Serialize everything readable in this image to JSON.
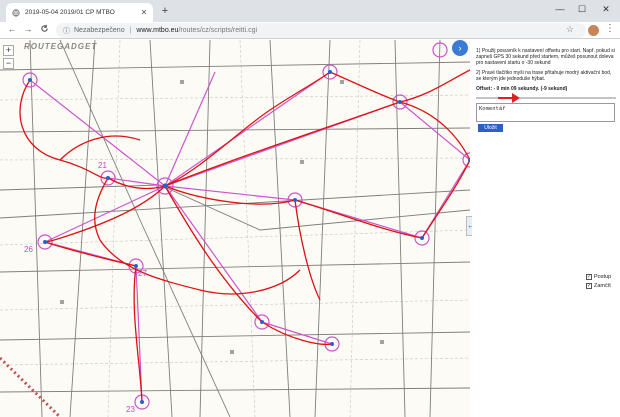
{
  "browser": {
    "tab_title": "2019-05-04 2019/01 ČP MTBO",
    "newtab_label": "+",
    "window": {
      "minimize": "—",
      "maximize": "☐",
      "close": "✕"
    },
    "nav": {
      "back": "←",
      "forward": "→",
      "reload": "C"
    },
    "omnibox": {
      "security": "Nezabezpečeno",
      "host": "www.mtbo.eu",
      "path": "/routes/cz/scripts/reitti.cgi"
    }
  },
  "map": {
    "logo": "ROUTEGADGET",
    "zoom_in": "+",
    "zoom_out": "−",
    "panel_toggle": "›",
    "side_handle": "↔",
    "control_numbers": [
      "21",
      "26",
      "27",
      "23"
    ],
    "colors": {
      "course": "#cc55cc",
      "route": "#dd1111",
      "water": "#3a7bd5"
    }
  },
  "panel": {
    "instruction1": "1) Použij posuvník k nastavení offsetu pro start. Např. pokud si zapneš GPS 30 sekund před startem, můžeš posunout doleva pro nastavení startu o -30 sekund",
    "instruction2": "2) Pravé tlačítko myši na trase přitahuje modrý aktivační bod, se kterým jde jednoduše hýbat.",
    "offset_label": "Offset: - 0 min 09 sekundy. (-9 sekund)",
    "comment_placeholder": "Komentář",
    "save_label": "Uložit",
    "checkboxes": [
      {
        "label": "Postup",
        "checked": true
      },
      {
        "label": "Zamčít",
        "checked": true
      }
    ]
  }
}
